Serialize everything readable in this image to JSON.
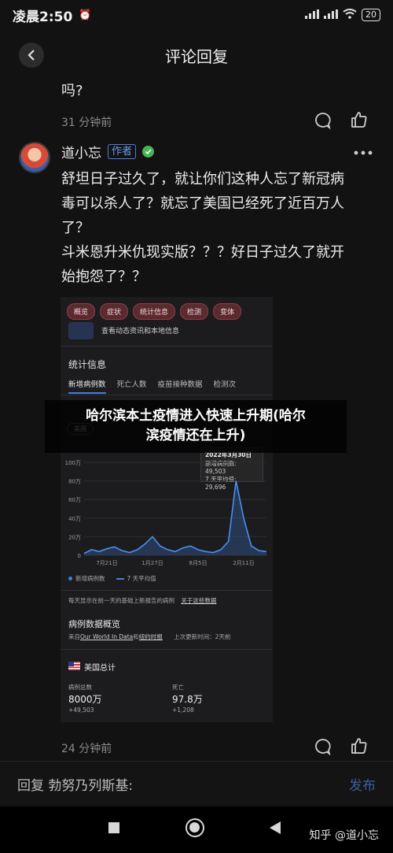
{
  "status_bar": {
    "time": "凌晨2:50",
    "battery": "20"
  },
  "header": {
    "title": "评论回复"
  },
  "prev_comment": {
    "tail": "吗?",
    "time": "31 分钟前"
  },
  "comment": {
    "author": "道小忘",
    "author_badge": "作者",
    "body_lines": [
      "舒坦日子过久了，就让你们这种人忘了新冠病",
      "毒可以杀人了？就忘了美国已经死了近百万人",
      "了？",
      "斗米恩升米仇现实版？？？好日子过久了就开",
      "始抱怨了？？"
    ],
    "time": "24 分钟前"
  },
  "embedded": {
    "chips": [
      "概览",
      "症状",
      "统计信息",
      "检测",
      "变体"
    ],
    "header_hint": "查看动态资讯和本地信息",
    "section_title": "统计信息",
    "tabs": [
      "新增病例数",
      "死亡人数",
      "疫苗接种数据",
      "检测次"
    ],
    "region": "美国",
    "tooltip": {
      "date": "2022年3月30日",
      "line1": "新增病例数: 49,503",
      "line2": "7 天平均值: 29,696"
    },
    "legend": [
      "新增病例数",
      "7 天平均值"
    ],
    "footnote": "每天显示在前一天的基础上新报告的病例",
    "footnote_link": "关于这些数据",
    "overview_title": "病例数据概览",
    "source_prefix": "来自",
    "source_owid": "Our World In Data",
    "source_and": "和",
    "source_nyt": "纽约时报",
    "source_updated": "上次更新时间：2天前",
    "total_title": "美国总计",
    "cases_label": "病例总数",
    "cases_value": "8000万",
    "cases_delta": "+49,503",
    "deaths_label": "死亡",
    "deaths_value": "97.8万",
    "deaths_delta": "+1,208"
  },
  "chart_data": {
    "type": "area",
    "x_tick_labels": [
      "7月21日",
      "1月27日",
      "8月5日",
      "2月11日"
    ],
    "y_tick_labels": [
      "100万",
      "80万",
      "60万",
      "40万",
      "20万",
      "0"
    ],
    "ylim": [
      0,
      1000000
    ],
    "series": [
      {
        "name": "新增病例数",
        "values": [
          20000,
          60000,
          40000,
          70000,
          90000,
          50000,
          30000,
          60000,
          120000,
          200000,
          100000,
          60000,
          40000,
          80000,
          100000,
          60000,
          40000,
          30000,
          60000,
          150000,
          800000,
          400000,
          100000,
          50000,
          40000
        ]
      }
    ]
  },
  "caption": {
    "line1": "哈尔滨本土疫情进入快速上升期(哈尔",
    "line2": "滨疫情还在上升)"
  },
  "input": {
    "placeholder": "回复 勃努乃列斯基:",
    "send": "发布"
  },
  "watermark": "知乎 @道小忘"
}
